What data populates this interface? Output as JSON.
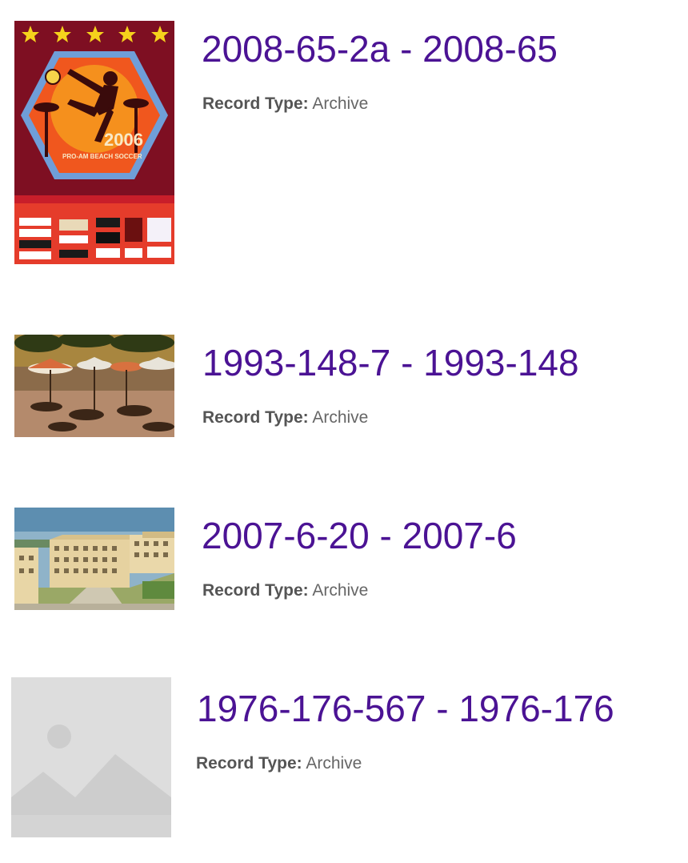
{
  "records": [
    {
      "title": "2008-65-2a - 2008-65",
      "record_type_label": "Record Type:",
      "record_type_value": "Archive",
      "thumbnail_icon": "beach-soccer-poster-image"
    },
    {
      "title": "1993-148-7 - 1993-148",
      "record_type_label": "Record Type:",
      "record_type_value": "Archive",
      "thumbnail_icon": "patio-umbrellas-photo-image"
    },
    {
      "title": "2007-6-20 - 2007-6",
      "record_type_label": "Record Type:",
      "record_type_value": "Archive",
      "thumbnail_icon": "apartment-buildings-photo-image"
    },
    {
      "title": "1976-176-567 - 1976-176",
      "record_type_label": "Record Type:",
      "record_type_value": "Archive",
      "thumbnail_icon": "image-placeholder-icon"
    }
  ],
  "colors": {
    "title": "#4b1394",
    "meta_text": "#666666",
    "placeholder_bg": "#dddddd"
  }
}
